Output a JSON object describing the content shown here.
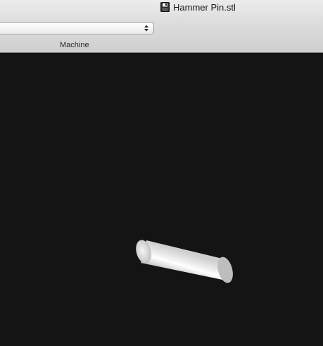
{
  "window": {
    "title": "Hammer Pin.stl",
    "title_icon": "document-icon"
  },
  "toolbar": {
    "selector_value": "",
    "selector_icon": "updown-arrows-icon",
    "machine_label": "Machine"
  },
  "viewport": {
    "background_color": "#141414",
    "model": {
      "name": "Hammer Pin",
      "shape": "cylinder",
      "color": "#e8e8e8"
    }
  }
}
